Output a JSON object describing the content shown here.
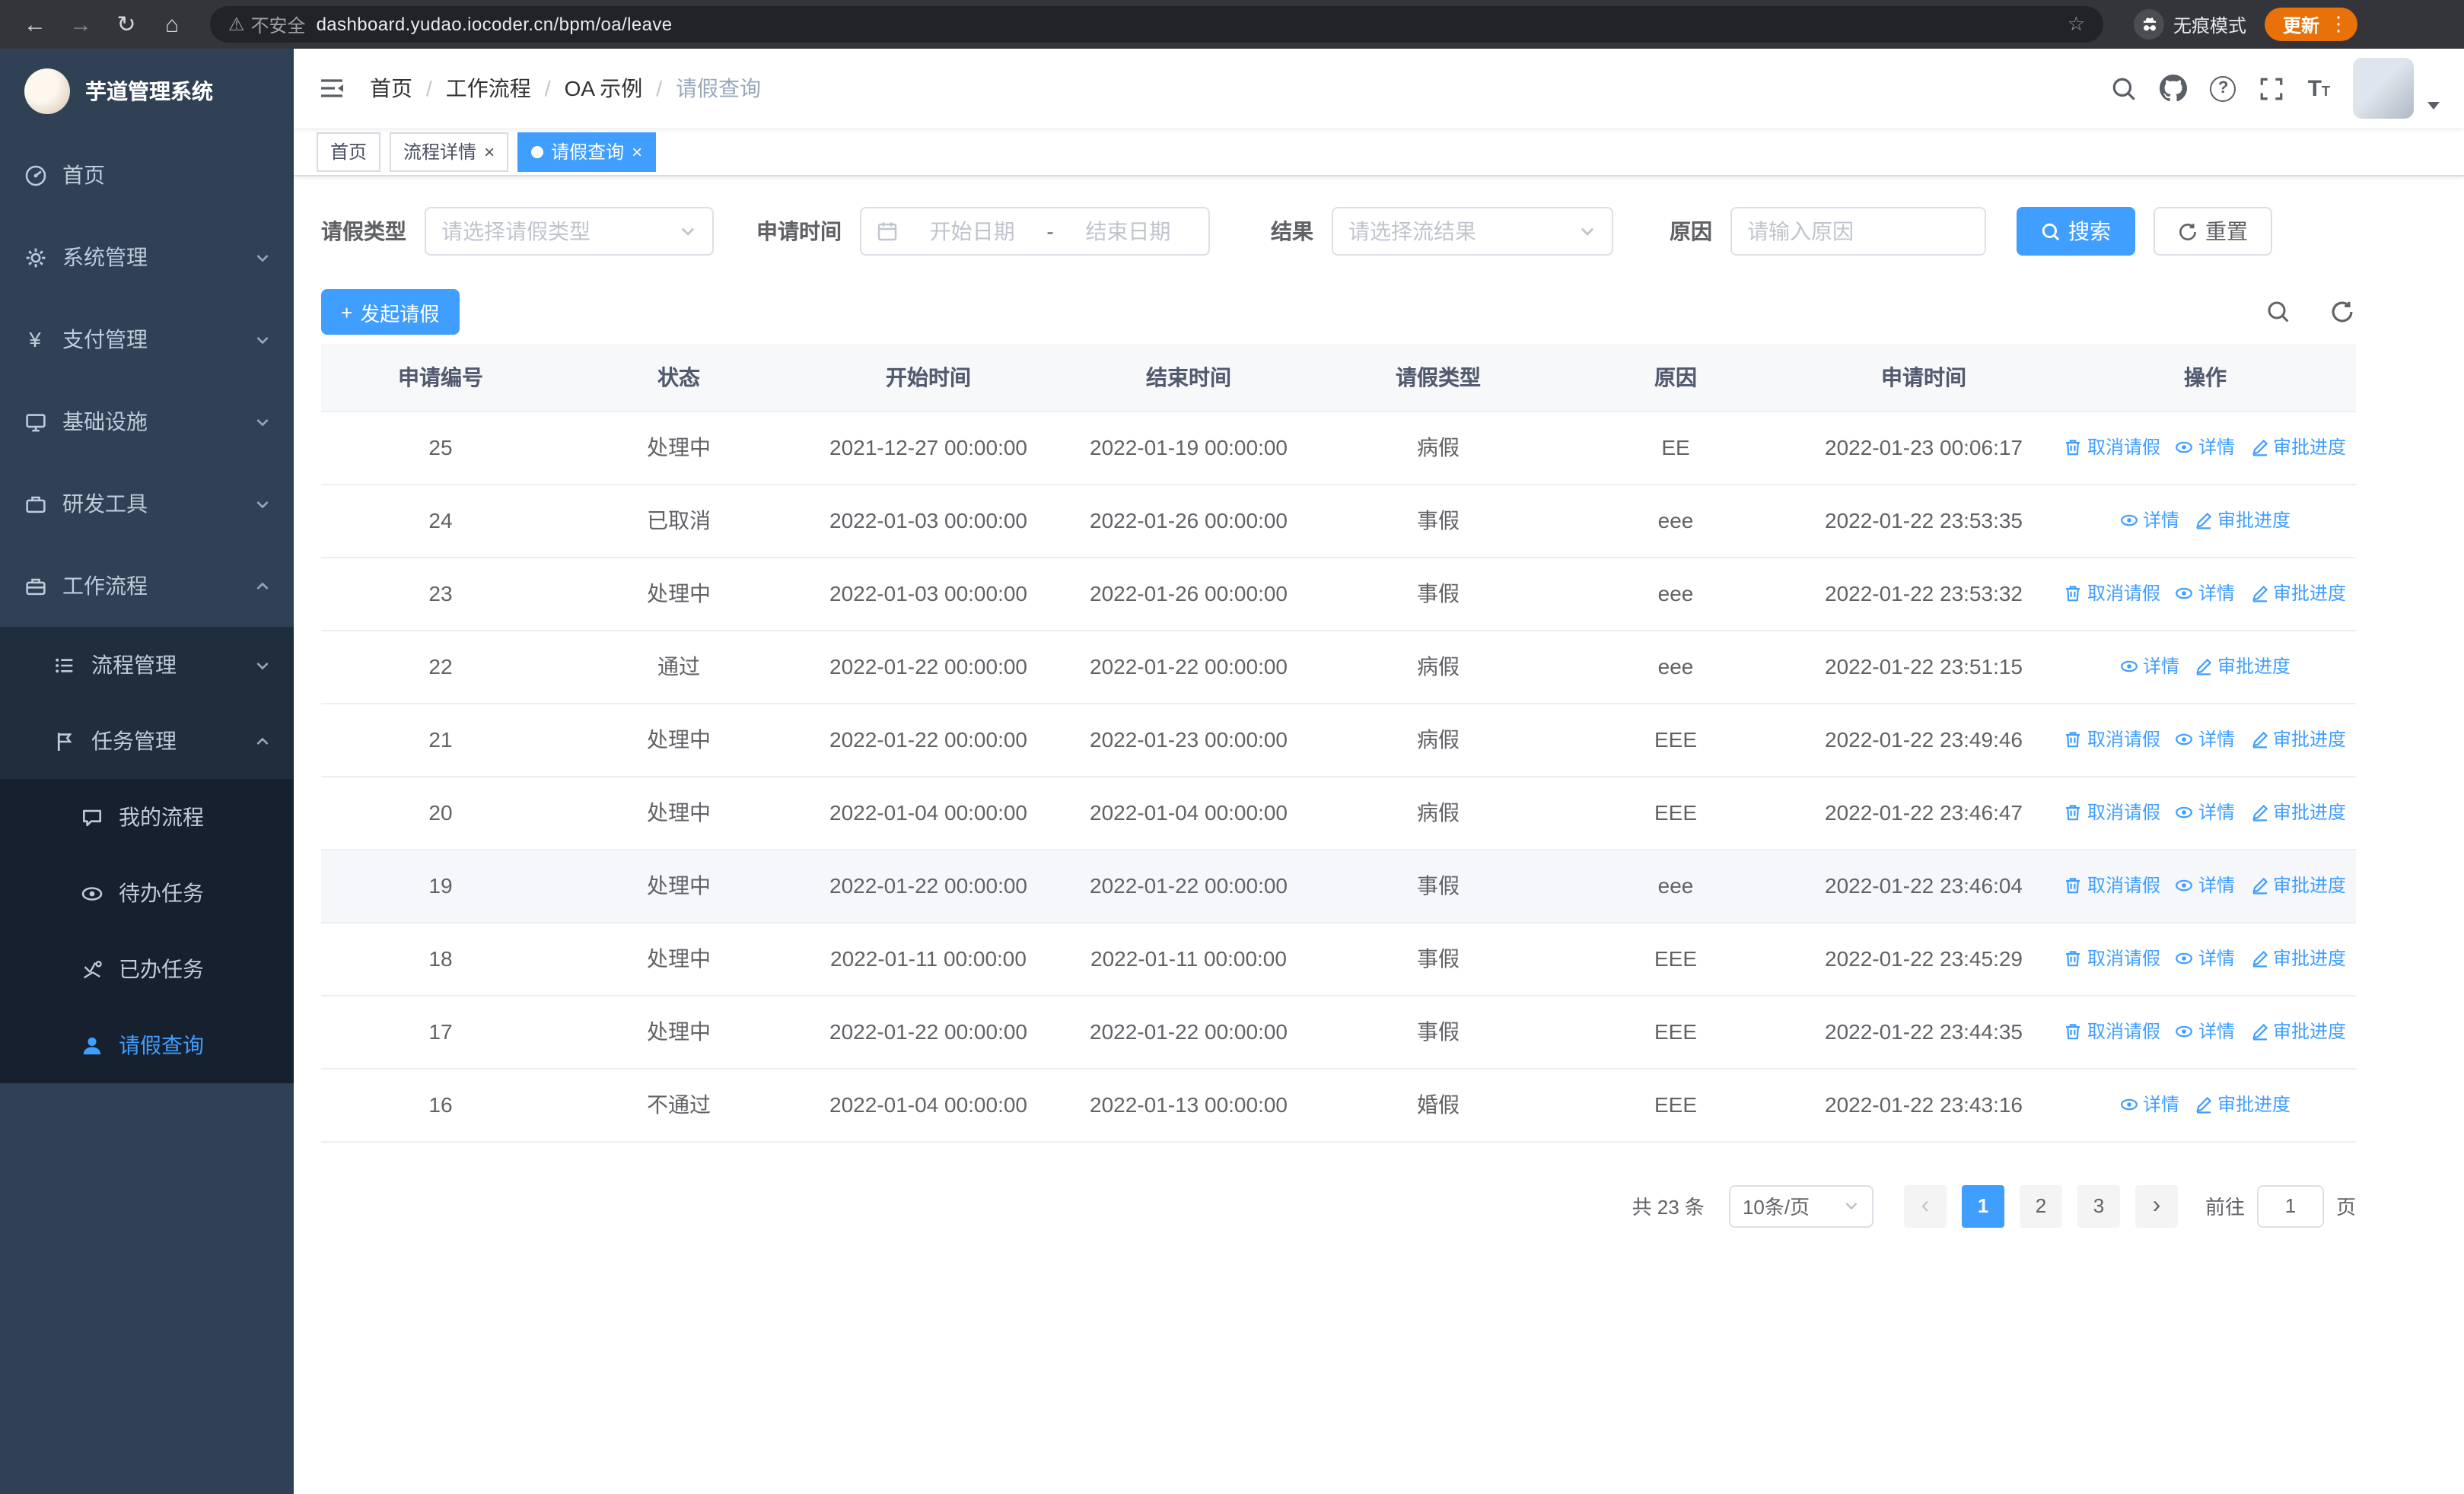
{
  "browser": {
    "url": "dashboard.yudao.iocoder.cn/bpm/oa/leave",
    "security_warning": "不安全",
    "incognito_label": "无痕模式",
    "update_button": "更新"
  },
  "icons": {
    "back_icon": "←",
    "forward_icon": "→",
    "reload_icon": "↻",
    "home_icon": "⌂",
    "warning_icon": "⚠",
    "star_icon": "☆",
    "menu_dots_icon": "⋮",
    "yen_icon": "¥",
    "plus_icon": "+",
    "close_icon": "×",
    "question_icon": "?",
    "font_big": "T",
    "font_small": "T",
    "prev_icon": "‹",
    "next_icon": "›"
  },
  "sidebar": {
    "logo_title": "芋道管理系统",
    "items": [
      {
        "label": "首页",
        "icon": "dashboard-icon"
      },
      {
        "label": "系统管理",
        "icon": "gear-icon"
      },
      {
        "label": "支付管理",
        "icon": "yen-icon"
      },
      {
        "label": "基础设施",
        "icon": "monitor-icon"
      },
      {
        "label": "研发工具",
        "icon": "briefcase-icon"
      },
      {
        "label": "工作流程",
        "icon": "workflow-icon"
      }
    ],
    "workflow_children": [
      {
        "label": "流程管理",
        "icon": "list-icon"
      },
      {
        "label": "任务管理",
        "icon": "flag-icon"
      }
    ],
    "task_children": [
      {
        "label": "我的流程",
        "icon": "chat-icon"
      },
      {
        "label": "待办任务",
        "icon": "eye-icon"
      },
      {
        "label": "已办任务",
        "icon": "check-icon"
      },
      {
        "label": "请假查询",
        "icon": "user-icon"
      }
    ]
  },
  "header": {
    "separator": "/",
    "breadcrumb": [
      "首页",
      "工作流程",
      "OA 示例",
      "请假查询"
    ]
  },
  "tabs": [
    {
      "label": "首页",
      "closable": false,
      "active": false
    },
    {
      "label": "流程详情",
      "closable": true,
      "active": false
    },
    {
      "label": "请假查询",
      "closable": true,
      "active": true
    }
  ],
  "filters": {
    "leave_type_label": "请假类型",
    "leave_type_placeholder": "请选择请假类型",
    "apply_time_label": "申请时间",
    "date_start_placeholder": "开始日期",
    "date_separator": "-",
    "date_end_placeholder": "结束日期",
    "result_label": "结果",
    "result_placeholder": "请选择流结果",
    "reason_label": "原因",
    "reason_placeholder": "请输入原因",
    "search_button": "搜索",
    "reset_button": "重置"
  },
  "toolbar": {
    "create_button": "发起请假"
  },
  "table": {
    "columns": [
      "申请编号",
      "状态",
      "开始时间",
      "结束时间",
      "请假类型",
      "原因",
      "申请时间",
      "操作"
    ],
    "action_labels": {
      "cancel": "取消请假",
      "detail": "详情",
      "progress": "审批进度"
    },
    "rows": [
      {
        "id": "25",
        "status": "处理中",
        "start": "2021-12-27 00:00:00",
        "end": "2022-01-19 00:00:00",
        "type": "病假",
        "reason": "EE",
        "applied": "2022-01-23 00:06:17",
        "cancellable": true,
        "highlighted": false
      },
      {
        "id": "24",
        "status": "已取消",
        "start": "2022-01-03 00:00:00",
        "end": "2022-01-26 00:00:00",
        "type": "事假",
        "reason": "eee",
        "applied": "2022-01-22 23:53:35",
        "cancellable": false,
        "highlighted": false
      },
      {
        "id": "23",
        "status": "处理中",
        "start": "2022-01-03 00:00:00",
        "end": "2022-01-26 00:00:00",
        "type": "事假",
        "reason": "eee",
        "applied": "2022-01-22 23:53:32",
        "cancellable": true,
        "highlighted": false
      },
      {
        "id": "22",
        "status": "通过",
        "start": "2022-01-22 00:00:00",
        "end": "2022-01-22 00:00:00",
        "type": "病假",
        "reason": "eee",
        "applied": "2022-01-22 23:51:15",
        "cancellable": false,
        "highlighted": false
      },
      {
        "id": "21",
        "status": "处理中",
        "start": "2022-01-22 00:00:00",
        "end": "2022-01-23 00:00:00",
        "type": "病假",
        "reason": "EEE",
        "applied": "2022-01-22 23:49:46",
        "cancellable": true,
        "highlighted": false
      },
      {
        "id": "20",
        "status": "处理中",
        "start": "2022-01-04 00:00:00",
        "end": "2022-01-04 00:00:00",
        "type": "病假",
        "reason": "EEE",
        "applied": "2022-01-22 23:46:47",
        "cancellable": true,
        "highlighted": false
      },
      {
        "id": "19",
        "status": "处理中",
        "start": "2022-01-22 00:00:00",
        "end": "2022-01-22 00:00:00",
        "type": "事假",
        "reason": "eee",
        "applied": "2022-01-22 23:46:04",
        "cancellable": true,
        "highlighted": true
      },
      {
        "id": "18",
        "status": "处理中",
        "start": "2022-01-11 00:00:00",
        "end": "2022-01-11 00:00:00",
        "type": "事假",
        "reason": "EEE",
        "applied": "2022-01-22 23:45:29",
        "cancellable": true,
        "highlighted": false
      },
      {
        "id": "17",
        "status": "处理中",
        "start": "2022-01-22 00:00:00",
        "end": "2022-01-22 00:00:00",
        "type": "事假",
        "reason": "EEE",
        "applied": "2022-01-22 23:44:35",
        "cancellable": true,
        "highlighted": false
      },
      {
        "id": "16",
        "status": "不通过",
        "start": "2022-01-04 00:00:00",
        "end": "2022-01-13 00:00:00",
        "type": "婚假",
        "reason": "EEE",
        "applied": "2022-01-22 23:43:16",
        "cancellable": false,
        "highlighted": false
      }
    ]
  },
  "pagination": {
    "total_text": "共 23 条",
    "page_size": "10条/页",
    "pages": [
      "1",
      "2",
      "3"
    ],
    "active_page": "1",
    "goto_label": "前往",
    "goto_value": "1",
    "goto_suffix": "页"
  },
  "colors": {
    "primary": "#409eff",
    "sidebar_bg": "#304156",
    "sidebar_sub_bg": "#1f2d3d",
    "table_border": "#ebeef5",
    "update_pill": "#e8710a"
  }
}
